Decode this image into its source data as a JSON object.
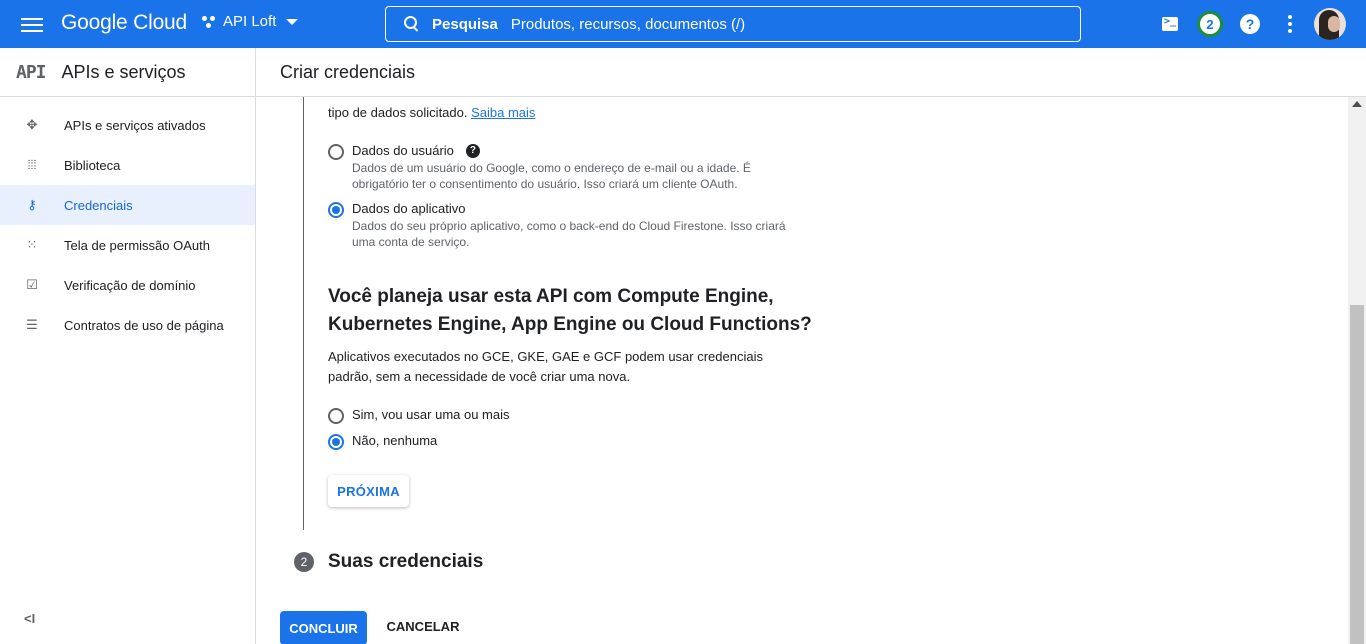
{
  "topbar": {
    "logo": "Google Cloud",
    "project": "API Loft",
    "search_label": "Pesquisa",
    "search_placeholder": "Produtos, recursos, documentos (/)",
    "notifications_count": "2",
    "help_glyph": "?",
    "accent_color": "#1a73e8"
  },
  "sidebar": {
    "logo_mark": "API",
    "title": "APIs e serviços",
    "items": [
      {
        "label": "APIs e serviços ativados",
        "icon": "apis-icon",
        "glyph": "✥"
      },
      {
        "label": "Biblioteca",
        "icon": "library-icon",
        "glyph": "⦙⦙⦙"
      },
      {
        "label": "Credenciais",
        "icon": "key-icon",
        "glyph": "⚷",
        "active": true
      },
      {
        "label": "Tela de permissão OAuth",
        "icon": "oauth-consent-icon",
        "glyph": "⁙"
      },
      {
        "label": "Verificação de domínio",
        "icon": "domain-verification-icon",
        "glyph": "☑"
      },
      {
        "label": "Contratos de uso de página",
        "icon": "page-usage-icon",
        "glyph": "☰"
      }
    ],
    "collapse_glyph": "<I"
  },
  "main": {
    "title": "Criar credenciais",
    "intro_text": "tipo de dados solicitado.",
    "learn_more": "Saiba mais",
    "data_options": [
      {
        "label": "Dados do usuário",
        "desc": "Dados de um usuário do Google, como o endereço de e-mail ou a idade. É obrigatório ter o consentimento do usuário. Isso criará um cliente OAuth.",
        "selected": false
      },
      {
        "label": "Dados do aplicativo",
        "desc": "Dados do seu próprio aplicativo, como o back-end do Cloud Firestone. Isso criará uma conta de serviço.",
        "selected": true
      }
    ],
    "question_title": "Você planeja usar esta API com Compute Engine, Kubernetes Engine, App Engine ou Cloud Functions?",
    "question_desc": "Aplicativos executados no GCE, GKE, GAE e GCF podem usar credenciais padrão, sem a necessidade de você criar uma nova.",
    "engine_options": [
      {
        "label": "Sim, vou usar uma ou mais",
        "selected": false
      },
      {
        "label": "Não, nenhuma",
        "selected": true
      }
    ],
    "next_button": "PRÓXIMA",
    "step2_number": "2",
    "step2_label": "Suas credenciais",
    "done_button": "CONCLUIR",
    "cancel_button": "CANCELAR"
  }
}
